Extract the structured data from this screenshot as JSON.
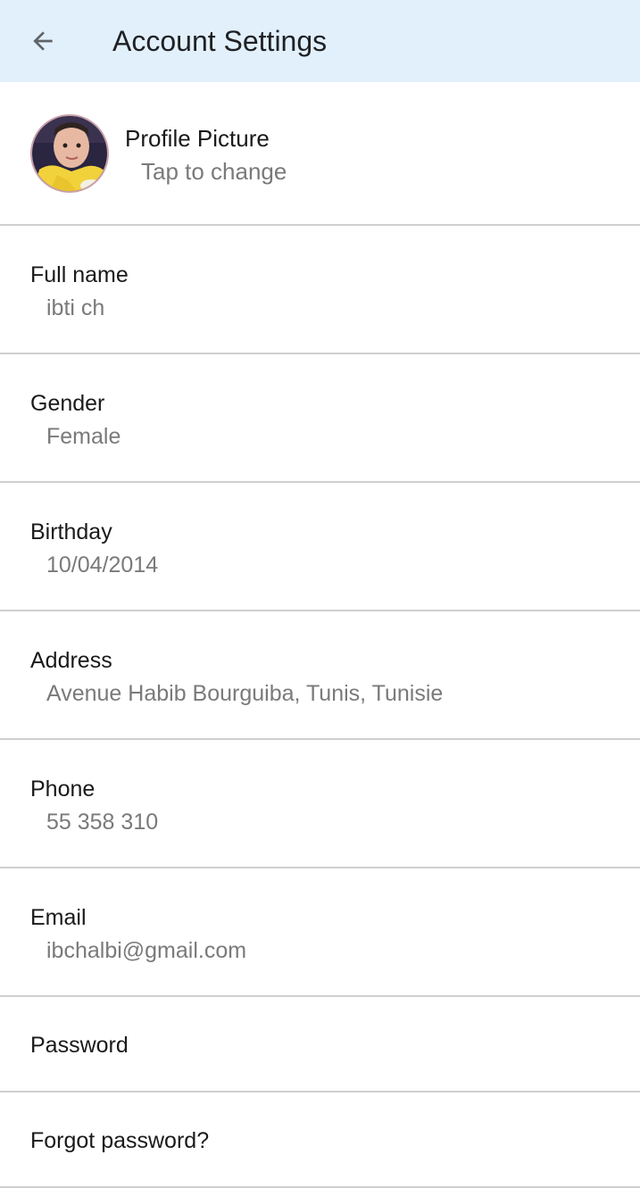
{
  "header": {
    "title": "Account Settings",
    "back_icon": "arrow-left-icon",
    "background": "#e2f0fc"
  },
  "profile_picture": {
    "label": "Profile Picture",
    "hint": "Tap to change"
  },
  "fields": {
    "full_name": {
      "label": "Full name",
      "value": "ibti ch"
    },
    "gender": {
      "label": "Gender",
      "value": "Female"
    },
    "birthday": {
      "label": "Birthday",
      "value": "10/04/2014"
    },
    "address": {
      "label": "Address",
      "value": "Avenue Habib Bourguiba, Tunis, Tunisie"
    },
    "phone": {
      "label": "Phone",
      "value": "55 358 310"
    },
    "email": {
      "label": "Email",
      "value": "ibchalbi@gmail.com"
    }
  },
  "actions": {
    "password": "Password",
    "forgot_password": "Forgot password?"
  }
}
